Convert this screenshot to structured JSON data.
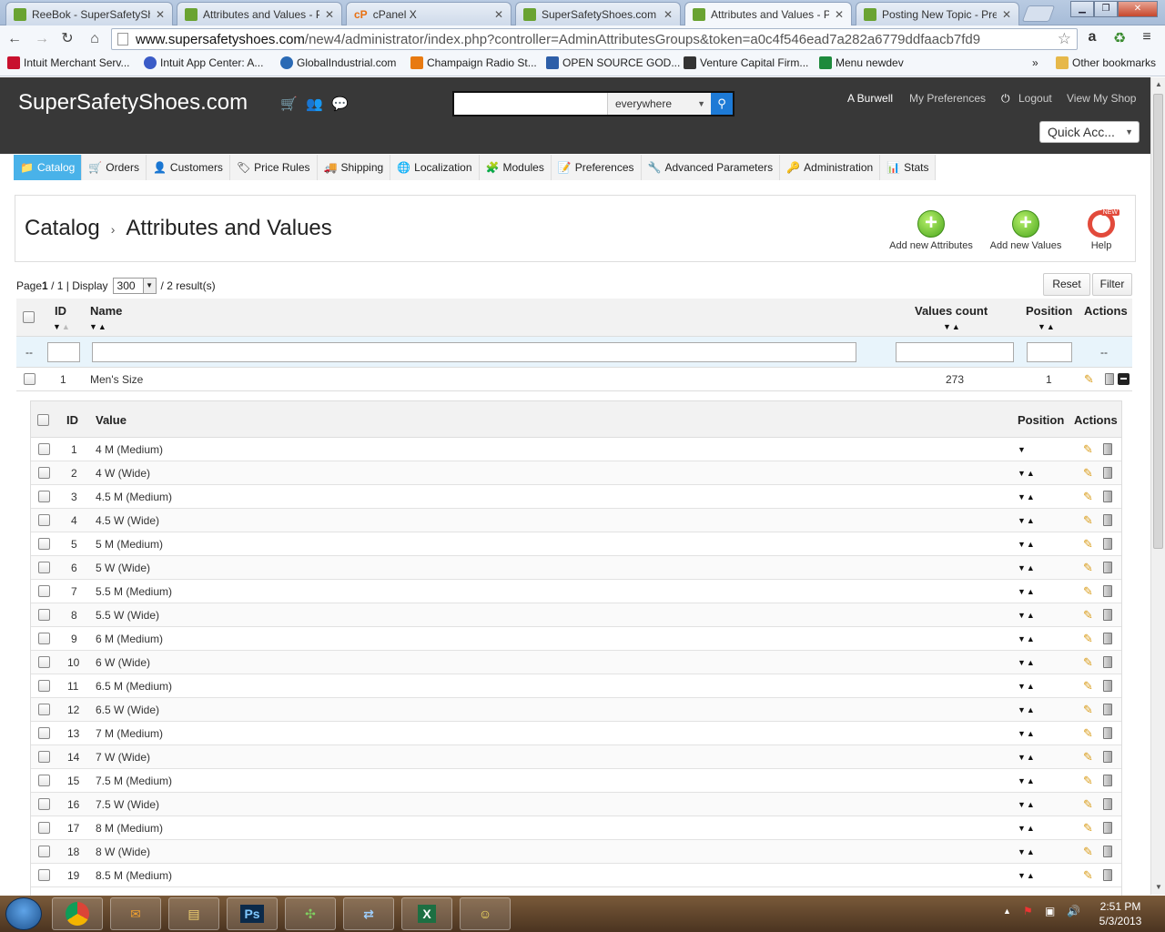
{
  "browser": {
    "tabs": [
      {
        "title": "ReeBok - SuperSafetySho",
        "icon": "leaf",
        "active": false
      },
      {
        "title": "Attributes and Values - P",
        "icon": "leaf",
        "active": false
      },
      {
        "title": "cPanel X",
        "icon": "cp",
        "active": false
      },
      {
        "title": "SuperSafetyShoes.com",
        "icon": "leaf",
        "active": false
      },
      {
        "title": "Attributes and Values - P",
        "icon": "leaf",
        "active": true
      },
      {
        "title": "Posting New Topic - Pres",
        "icon": "leaf",
        "active": false
      }
    ],
    "url_host": "www.supersafetyshoes.com",
    "url_path": "/new4/administrator/index.php?controller=AdminAttributesGroups&token=a0c4f546ead7a282a6779ddfaacb7fd9",
    "bookmarks": [
      "Intuit Merchant Serv...",
      "Intuit App Center: A...",
      "GlobalIndustrial.com",
      "Champaign Radio St...",
      "OPEN SOURCE GOD...",
      "Venture Capital Firm...",
      "Menu newdev"
    ],
    "other_bookmarks": "Other bookmarks",
    "bookmarks_overflow": "»"
  },
  "header": {
    "logo": "SuperSafetyShoes.com",
    "search_scope": "everywhere",
    "user": "A Burwell",
    "my_preferences": "My Preferences",
    "logout": "Logout",
    "view_shop": "View My Shop",
    "quick_access": "Quick Acc..."
  },
  "menu": [
    {
      "label": "Catalog",
      "active": true
    },
    {
      "label": "Orders"
    },
    {
      "label": "Customers"
    },
    {
      "label": "Price Rules"
    },
    {
      "label": "Shipping"
    },
    {
      "label": "Localization"
    },
    {
      "label": "Modules"
    },
    {
      "label": "Preferences"
    },
    {
      "label": "Advanced Parameters"
    },
    {
      "label": "Administration"
    },
    {
      "label": "Stats"
    }
  ],
  "page": {
    "crumb_root": "Catalog",
    "crumb_sep": "›",
    "title": "Attributes and Values",
    "add_attributes": "Add new Attributes",
    "add_values": "Add new Values",
    "help": "Help",
    "help_badge": "NEW"
  },
  "pager": {
    "page_label": "Page",
    "page": "1",
    "total_pages": "/ 1 | Display",
    "per_page": "300",
    "results": "/ 2 result(s)",
    "reset": "Reset",
    "filter": "Filter"
  },
  "table": {
    "headers": {
      "id": "ID",
      "name": "Name",
      "values_count": "Values count",
      "position": "Position",
      "actions": "Actions"
    },
    "filter_dash": "--",
    "filter_dash_actions": "--",
    "rows": [
      {
        "id": "1",
        "name": "Men's Size",
        "values_count": "273",
        "position": "1"
      }
    ]
  },
  "subtable": {
    "headers": {
      "id": "ID",
      "value": "Value",
      "position": "Position",
      "actions": "Actions"
    },
    "rows": [
      {
        "id": "1",
        "value": "4 M (Medium)",
        "first": true
      },
      {
        "id": "2",
        "value": "4 W (Wide)"
      },
      {
        "id": "3",
        "value": "4.5 M (Medium)"
      },
      {
        "id": "4",
        "value": "4.5 W (Wide)"
      },
      {
        "id": "5",
        "value": "5 M (Medium)"
      },
      {
        "id": "6",
        "value": "5 W (Wide)"
      },
      {
        "id": "7",
        "value": "5.5 M (Medium)"
      },
      {
        "id": "8",
        "value": "5.5 W (Wide)"
      },
      {
        "id": "9",
        "value": "6 M (Medium)"
      },
      {
        "id": "10",
        "value": "6 W (Wide)"
      },
      {
        "id": "11",
        "value": "6.5 M (Medium)"
      },
      {
        "id": "12",
        "value": "6.5 W (Wide)"
      },
      {
        "id": "13",
        "value": "7 M (Medium)"
      },
      {
        "id": "14",
        "value": "7 W (Wide)"
      },
      {
        "id": "15",
        "value": "7.5 M (Medium)"
      },
      {
        "id": "16",
        "value": "7.5 W (Wide)"
      },
      {
        "id": "17",
        "value": "8 M (Medium)"
      },
      {
        "id": "18",
        "value": "8 W (Wide)"
      },
      {
        "id": "19",
        "value": "8.5 M (Medium)"
      }
    ]
  },
  "taskbar": {
    "apps": [
      "chrome",
      "outlook",
      "explorer",
      "Ps",
      "game",
      "network",
      "excel",
      "notes"
    ],
    "time": "2:51 PM",
    "date": "5/3/2013"
  },
  "colors": {
    "accent": "#49b2e9",
    "header_bg": "#383838",
    "search_btn": "#1d7ad6"
  }
}
